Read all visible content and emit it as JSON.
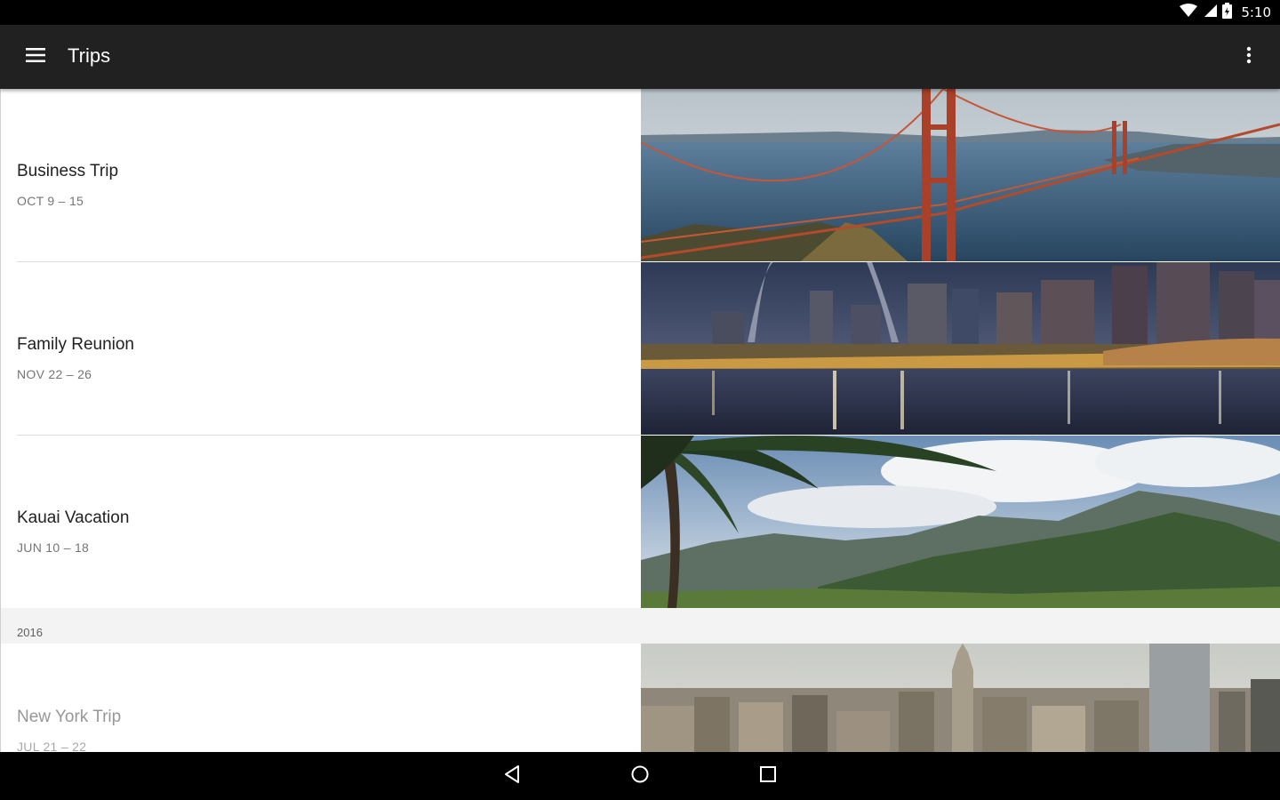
{
  "status_bar": {
    "time": "5:10"
  },
  "app_bar": {
    "title": "Trips"
  },
  "trips": [
    {
      "name": "Business Trip",
      "dates": "OCT 9 – 15"
    },
    {
      "name": "Family Reunion",
      "dates": "NOV 22 – 26"
    },
    {
      "name": "Kauai Vacation",
      "dates": "JUN 10 – 18"
    }
  ],
  "sections": [
    {
      "label": "2016",
      "trips": [
        {
          "name": "New York Trip",
          "dates": "JUL 21 – 22"
        }
      ]
    }
  ],
  "icons": {
    "menu": "menu-icon",
    "overflow": "more-vert-icon",
    "wifi": "wifi-icon",
    "signal": "cell-signal-icon",
    "battery": "battery-icon",
    "back": "back-icon",
    "home": "home-icon",
    "recents": "recents-icon"
  },
  "colors": {
    "app_bar": "#212121",
    "status_bar": "#000000",
    "nav_bar": "#000000"
  }
}
